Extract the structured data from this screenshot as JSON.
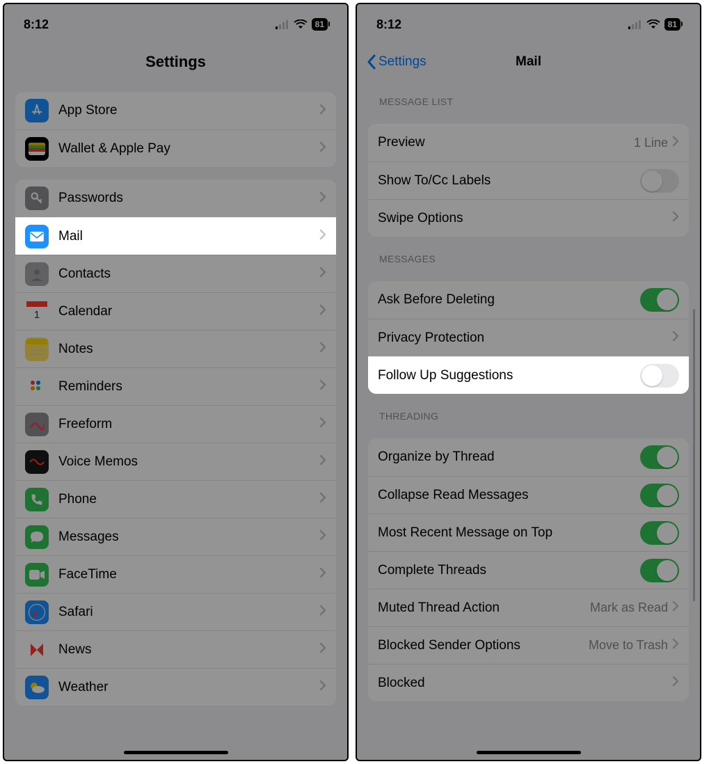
{
  "status": {
    "time": "8:12",
    "battery": "81"
  },
  "left": {
    "title": "Settings",
    "groups": [
      {
        "items": [
          {
            "id": "appstore",
            "label": "App Store",
            "iconBg": "#1e90ff"
          },
          {
            "id": "wallet",
            "label": "Wallet & Apple Pay",
            "iconBg": "#000"
          }
        ]
      },
      {
        "items": [
          {
            "id": "passwords",
            "label": "Passwords",
            "iconBg": "#8e8e93"
          },
          {
            "id": "mail",
            "label": "Mail",
            "iconBg": "#1e90ff",
            "highlight": true
          },
          {
            "id": "contacts",
            "label": "Contacts",
            "iconBg": "#a7a7ad"
          },
          {
            "id": "calendar",
            "label": "Calendar",
            "iconBg": "#fff"
          },
          {
            "id": "notes",
            "label": "Notes",
            "iconBg": "#ffe066"
          },
          {
            "id": "reminders",
            "label": "Reminders",
            "iconBg": "#fff"
          },
          {
            "id": "freeform",
            "label": "Freeform",
            "iconBg": "#8e8e93"
          },
          {
            "id": "voicememos",
            "label": "Voice Memos",
            "iconBg": "#1a1a1a"
          },
          {
            "id": "phone",
            "label": "Phone",
            "iconBg": "#34c759"
          },
          {
            "id": "messages",
            "label": "Messages",
            "iconBg": "#34c759"
          },
          {
            "id": "facetime",
            "label": "FaceTime",
            "iconBg": "#34c759"
          },
          {
            "id": "safari",
            "label": "Safari",
            "iconBg": "#1e90ff"
          },
          {
            "id": "news",
            "label": "News",
            "iconBg": "#fff"
          },
          {
            "id": "weather",
            "label": "Weather",
            "iconBg": "#1e90ff"
          }
        ]
      }
    ]
  },
  "right": {
    "back": "Settings",
    "title": "Mail",
    "sections": [
      {
        "header": "Message List",
        "rows": [
          {
            "id": "preview",
            "label": "Preview",
            "value": "1 Line",
            "type": "nav"
          },
          {
            "id": "tocc",
            "label": "Show To/Cc Labels",
            "type": "toggle",
            "on": false
          },
          {
            "id": "swipe",
            "label": "Swipe Options",
            "type": "nav"
          }
        ]
      },
      {
        "header": "Messages",
        "rows": [
          {
            "id": "askdel",
            "label": "Ask Before Deleting",
            "type": "toggle",
            "on": true
          },
          {
            "id": "privacy",
            "label": "Privacy Protection",
            "type": "nav"
          },
          {
            "id": "followup",
            "label": "Follow Up Suggestions",
            "type": "toggle",
            "on": false,
            "highlight": true
          }
        ]
      },
      {
        "header": "Threading",
        "rows": [
          {
            "id": "organize",
            "label": "Organize by Thread",
            "type": "toggle",
            "on": true
          },
          {
            "id": "collapse",
            "label": "Collapse Read Messages",
            "type": "toggle",
            "on": true
          },
          {
            "id": "recent",
            "label": "Most Recent Message on Top",
            "type": "toggle",
            "on": true
          },
          {
            "id": "complete",
            "label": "Complete Threads",
            "type": "toggle",
            "on": true
          },
          {
            "id": "muted",
            "label": "Muted Thread Action",
            "value": "Mark as Read",
            "type": "nav"
          },
          {
            "id": "blockedopt",
            "label": "Blocked Sender Options",
            "value": "Move to Trash",
            "type": "nav"
          },
          {
            "id": "blocked",
            "label": "Blocked",
            "type": "nav"
          }
        ]
      }
    ]
  }
}
